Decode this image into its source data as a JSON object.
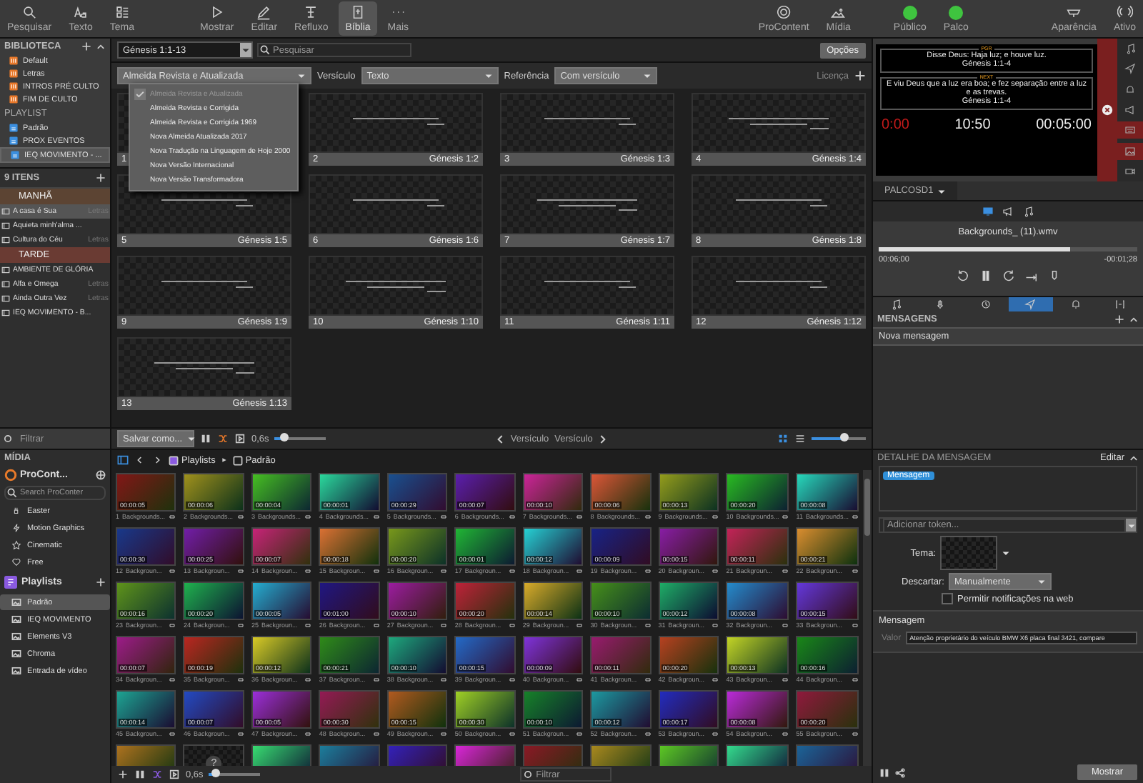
{
  "toolbar": {
    "groups": [
      [
        {
          "label": "Pesquisar",
          "selected": false
        },
        {
          "label": "Texto",
          "selected": false
        },
        {
          "label": "Tema",
          "selected": false
        }
      ],
      [
        {
          "label": "Mostrar",
          "selected": false
        },
        {
          "label": "Editar",
          "selected": false
        },
        {
          "label": "Refluxo",
          "selected": false
        },
        {
          "label": "Bíblia",
          "selected": true
        },
        {
          "label": "Mais",
          "selected": false
        }
      ],
      [
        {
          "label": "ProContent",
          "selected": false
        },
        {
          "label": "Mídia",
          "selected": false
        }
      ],
      [
        {
          "label": "Público",
          "kind": "status",
          "on": true
        },
        {
          "label": "Palco",
          "kind": "status",
          "on": true
        }
      ],
      [
        {
          "label": "Aparência",
          "selected": false
        },
        {
          "label": "Ativo",
          "selected": false
        }
      ]
    ]
  },
  "library": {
    "title": "BIBLIOTECA",
    "items": [
      "Default",
      "Letras",
      "INTROS PRÉ CULTO",
      "FIM DE CULTO"
    ],
    "playlist_title": "PLAYLIST",
    "playlists": [
      {
        "label": "Padrão",
        "selected": false
      },
      {
        "label": "PROX EVENTOS",
        "selected": false
      },
      {
        "label": "IEQ MOVIMENTO - ...",
        "selected": true
      }
    ]
  },
  "items_panel": {
    "count": "9 ITENS",
    "rows": [
      {
        "kind": "header",
        "title": "MANHÃ",
        "color": "#5c4433"
      },
      {
        "kind": "item",
        "title": "A casa é Sua",
        "type": "Letras",
        "selected": true
      },
      {
        "kind": "item",
        "title": "Aquieta minh'alma ...",
        "selected": false
      },
      {
        "kind": "item",
        "title": "Cultura do Céu",
        "type": "Letras",
        "selected": false
      },
      {
        "kind": "header",
        "title": "TARDE",
        "color": "#6a3b33"
      },
      {
        "kind": "item",
        "title": "AMBIENTE DE GLÓRIA",
        "selected": false
      },
      {
        "kind": "item",
        "title": "Alfa e Omega",
        "type": "Letras",
        "selected": false
      },
      {
        "kind": "item",
        "title": "Ainda Outra Vez",
        "type": "Letras",
        "selected": false
      },
      {
        "kind": "item",
        "title": "IEQ MOVIMENTO - B...",
        "selected": false
      }
    ],
    "filter_placeholder": "Filtrar"
  },
  "bible": {
    "passage": "Génesis 1:1-13",
    "search_placeholder": "Pesquisar",
    "options_button": "Opções",
    "translation": "Almeida Revista e Atualizada",
    "verse_label": "Versículo",
    "verse_value": "Texto",
    "reference_label": "Referência",
    "reference_value": "Com versículo",
    "license": "Licença",
    "translation_menu": [
      {
        "label": "Almeida Revista e Atualizada",
        "selected": true
      },
      {
        "label": "Almeida Revista e Corrigida",
        "selected": false
      },
      {
        "label": "Almeida Revista e Corrigida 1969",
        "selected": false
      },
      {
        "label": "Nova Almeida Atualizada 2017",
        "selected": false
      },
      {
        "label": "Nova Tradução na Linguagem de Hoje 2000",
        "selected": false
      },
      {
        "label": "Nova Versão Internacional",
        "selected": false
      },
      {
        "label": "Nova Versão Transformadora",
        "selected": false
      }
    ],
    "slides": [
      {
        "number": "1"
      },
      {
        "number": "2",
        "reference": "Génesis 1:2"
      },
      {
        "number": "3",
        "reference": "Génesis 1:3"
      },
      {
        "number": "4",
        "reference": "Génesis 1:4"
      },
      {
        "number": "5",
        "reference": "Génesis 1:5"
      },
      {
        "number": "6",
        "reference": "Génesis 1:6"
      },
      {
        "number": "7",
        "reference": "Génesis 1:7"
      },
      {
        "number": "8",
        "reference": "Génesis 1:8"
      },
      {
        "number": "9",
        "reference": "Génesis 1:9"
      },
      {
        "number": "10",
        "reference": "Génesis 1:10"
      },
      {
        "number": "11",
        "reference": "Génesis 1:11"
      },
      {
        "number": "12",
        "reference": "Génesis 1:12"
      },
      {
        "number": "13",
        "reference": "Génesis 1:13"
      }
    ],
    "save_as": "Salvar como...",
    "speed": "0,6s",
    "speed_slider": {
      "level": 0.2
    },
    "prev_label": "Versículo",
    "next_label": "Versículo",
    "zoom_slider": {
      "level": 0.6
    }
  },
  "stage": {
    "current_tag": "PGR",
    "current_text": "Disse Deus: Haja luz;  e houve luz.",
    "current_ref": "Génesis 1:1-4",
    "next_tag": "NEXT",
    "next_text": "E viu Deus que a luz era boa; e fez separação entre a luz e as trevas.",
    "next_ref": "Génesis 1:1-4",
    "timer_1": "0:00",
    "timer_2": "10:50",
    "timer_3": "00:05:00",
    "screen": "PALCOSD1"
  },
  "player": {
    "tabs": [
      {
        "selected": true
      },
      {
        "selected": false
      },
      {
        "selected": false
      }
    ],
    "title": "Backgrounds_ (11).wmv",
    "level": 0.74,
    "elapsed": "00:06;00",
    "remaining": "-00:01;28"
  },
  "messages": {
    "tabs": [
      {
        "selected": false
      },
      {
        "selected": false
      },
      {
        "selected": false
      },
      {
        "selected": true
      },
      {
        "selected": false
      },
      {
        "selected": false
      }
    ],
    "title": "MENSAGENS",
    "items": [
      "Nova mensagem"
    ]
  },
  "media": {
    "title": "MÍDIA",
    "procontent": "ProCont...",
    "search_placeholder": "Search ProConter",
    "categories": [
      "Easter",
      "Motion Graphics",
      "Cinematic",
      "Free"
    ],
    "playlists_title": "Playlists",
    "playlists": [
      {
        "label": "Padrão",
        "selected": true
      },
      {
        "label": "IEQ MOVIMENTO",
        "selected": false
      },
      {
        "label": "Elements V3",
        "selected": false
      },
      {
        "label": "Chroma",
        "selected": false
      },
      {
        "label": "Entrada de vídeo",
        "selected": false
      }
    ],
    "breadcrumb": [
      "Playlists",
      "Padrão"
    ],
    "speed": "0,6s",
    "speed_slider": {
      "level": 0.12
    },
    "filter_placeholder": "Filtrar",
    "items": [
      {
        "kind": "clip",
        "number": "1",
        "label": "Backgrounds...",
        "duration": "00:00:05"
      },
      {
        "kind": "clip",
        "number": "2",
        "label": "Backgrounds...",
        "duration": "00:00:06"
      },
      {
        "kind": "clip",
        "number": "3",
        "label": "Backgrounds...",
        "duration": "00:00:04"
      },
      {
        "kind": "clip",
        "number": "4",
        "label": "Backgrounds...",
        "duration": "00:00:01"
      },
      {
        "kind": "clip",
        "number": "5",
        "label": "Backgrounds...",
        "duration": "00:00:29"
      },
      {
        "kind": "clip",
        "number": "6",
        "label": "Backgrounds...",
        "duration": "00:00:07"
      },
      {
        "kind": "clip",
        "number": "7",
        "label": "Backgrounds...",
        "duration": "00:00:10"
      },
      {
        "kind": "clip",
        "number": "8",
        "label": "Backgrounds...",
        "duration": "00:00:06"
      },
      {
        "kind": "clip",
        "number": "9",
        "label": "Backgrounds...",
        "duration": "00:00:13"
      },
      {
        "kind": "clip",
        "number": "10",
        "label": "Backgrounds...",
        "duration": "00:00:20"
      },
      {
        "kind": "clip",
        "number": "11",
        "label": "Backgrounds...",
        "duration": "00:00:08"
      },
      {
        "kind": "clip",
        "number": "12",
        "label": "Backgroun...",
        "duration": "00:00:30"
      },
      {
        "kind": "clip",
        "number": "13",
        "label": "Backgroun...",
        "duration": "00:00:25"
      },
      {
        "kind": "clip",
        "number": "14",
        "label": "Backgroun...",
        "duration": "00:00:07"
      },
      {
        "kind": "clip",
        "number": "15",
        "label": "Backgroun...",
        "duration": "00:00:18"
      },
      {
        "kind": "clip",
        "number": "16",
        "label": "Backgroun...",
        "duration": "00:00:20"
      },
      {
        "kind": "clip",
        "number": "17",
        "label": "Backgroun...",
        "duration": "00:00:01"
      },
      {
        "kind": "clip",
        "number": "18",
        "label": "Backgroun...",
        "duration": "00:00:12"
      },
      {
        "kind": "clip",
        "number": "19",
        "label": "Backgroun...",
        "duration": "00:00:09"
      },
      {
        "kind": "clip",
        "number": "20",
        "label": "Backgroun...",
        "duration": "00:00:15"
      },
      {
        "kind": "clip",
        "number": "21",
        "label": "Backgroun...",
        "duration": "00:00:11"
      },
      {
        "kind": "clip",
        "number": "22",
        "label": "Backgroun...",
        "duration": "00:00:21"
      },
      {
        "kind": "clip",
        "number": "23",
        "label": "Backgroun...",
        "duration": "00:00:16"
      },
      {
        "kind": "clip",
        "number": "24",
        "label": "Backgroun...",
        "duration": "00:00:20"
      },
      {
        "kind": "clip",
        "number": "25",
        "label": "Backgroun...",
        "duration": "00:00:05"
      },
      {
        "kind": "clip",
        "number": "26",
        "label": "Backgroun...",
        "duration": "00:01:00"
      },
      {
        "kind": "clip",
        "number": "27",
        "label": "Backgroun...",
        "duration": "00:00:10"
      },
      {
        "kind": "clip",
        "number": "28",
        "label": "Backgroun...",
        "duration": "00:00:20"
      },
      {
        "kind": "clip",
        "number": "29",
        "label": "Backgroun...",
        "duration": "00:00:14"
      },
      {
        "kind": "clip",
        "number": "30",
        "label": "Backgroun...",
        "duration": "00:00:10"
      },
      {
        "kind": "clip",
        "number": "31",
        "label": "Backgroun...",
        "duration": "00:00:12"
      },
      {
        "kind": "clip",
        "number": "32",
        "label": "Backgroun...",
        "duration": "00:00:08"
      },
      {
        "kind": "clip",
        "number": "33",
        "label": "Backgroun...",
        "duration": "00:00:15"
      },
      {
        "kind": "clip",
        "number": "34",
        "label": "Backgroun...",
        "duration": "00:00:07"
      },
      {
        "kind": "clip",
        "number": "35",
        "label": "Backgroun...",
        "duration": "00:00:19"
      },
      {
        "kind": "clip",
        "number": "36",
        "label": "Backgroun...",
        "duration": "00:00:12"
      },
      {
        "kind": "clip",
        "number": "37",
        "label": "Backgroun...",
        "duration": "00:00:21"
      },
      {
        "kind": "clip",
        "number": "38",
        "label": "Backgroun...",
        "duration": "00:00:10"
      },
      {
        "kind": "clip",
        "number": "39",
        "label": "Backgroun...",
        "duration": "00:00:15"
      },
      {
        "kind": "clip",
        "number": "40",
        "label": "Backgroun...",
        "duration": "00:00:09"
      },
      {
        "kind": "clip",
        "number": "41",
        "label": "Backgroun...",
        "duration": "00:00:11"
      },
      {
        "kind": "clip",
        "number": "42",
        "label": "Backgroun...",
        "duration": "00:00:20"
      },
      {
        "kind": "clip",
        "number": "43",
        "label": "Backgroun...",
        "duration": "00:00:13"
      },
      {
        "kind": "clip",
        "number": "44",
        "label": "Backgroun...",
        "duration": "00:00:16"
      },
      {
        "kind": "clip",
        "number": "45",
        "label": "Backgroun...",
        "duration": "00:00:14"
      },
      {
        "kind": "clip",
        "number": "46",
        "label": "Backgroun...",
        "duration": "00:00:07"
      },
      {
        "kind": "clip",
        "number": "47",
        "label": "Backgroun...",
        "duration": "00:00:05"
      },
      {
        "kind": "clip",
        "number": "48",
        "label": "Backgroun...",
        "duration": "00:00:30"
      },
      {
        "kind": "clip",
        "number": "49",
        "label": "Backgroun...",
        "duration": "00:00:15"
      },
      {
        "kind": "clip",
        "number": "50",
        "label": "Backgroun...",
        "duration": "00:00:30"
      },
      {
        "kind": "clip",
        "number": "51",
        "label": "Backgroun...",
        "duration": "00:00:10"
      },
      {
        "kind": "clip",
        "number": "52",
        "label": "Backgroun...",
        "duration": "00:00:12"
      },
      {
        "kind": "clip",
        "number": "53",
        "label": "Backgroun...",
        "duration": "00:00:17"
      },
      {
        "kind": "clip",
        "number": "54",
        "label": "Backgroun...",
        "duration": "00:00:08"
      },
      {
        "kind": "clip",
        "number": "55",
        "label": "Backgroun...",
        "duration": "00:00:20"
      },
      {
        "kind": "cut"
      },
      {
        "kind": "missing",
        "mark": "?"
      },
      {
        "kind": "cut"
      },
      {
        "kind": "cut"
      },
      {
        "kind": "cut"
      },
      {
        "kind": "cut"
      },
      {
        "kind": "cut"
      },
      {
        "kind": "cut"
      },
      {
        "kind": "cut"
      },
      {
        "kind": "cut"
      },
      {
        "kind": "cut"
      }
    ]
  },
  "detail": {
    "title": "DETALHE DA MENSAGEM",
    "edit": "Editar",
    "token": "Mensagem",
    "token_placeholder": "Adicionar token...",
    "theme_label": "Tema:",
    "dismiss_label": "Descartar:",
    "dismiss_value": "Manualmente",
    "web_notify": {
      "label": "Permitir notificações na web",
      "checked": false
    },
    "section": "Mensagem",
    "value_label": "Valor",
    "value": "Atenção proprietário do veículo BMW X6 placa final 3421, compare",
    "show_button": "Mostrar"
  }
}
